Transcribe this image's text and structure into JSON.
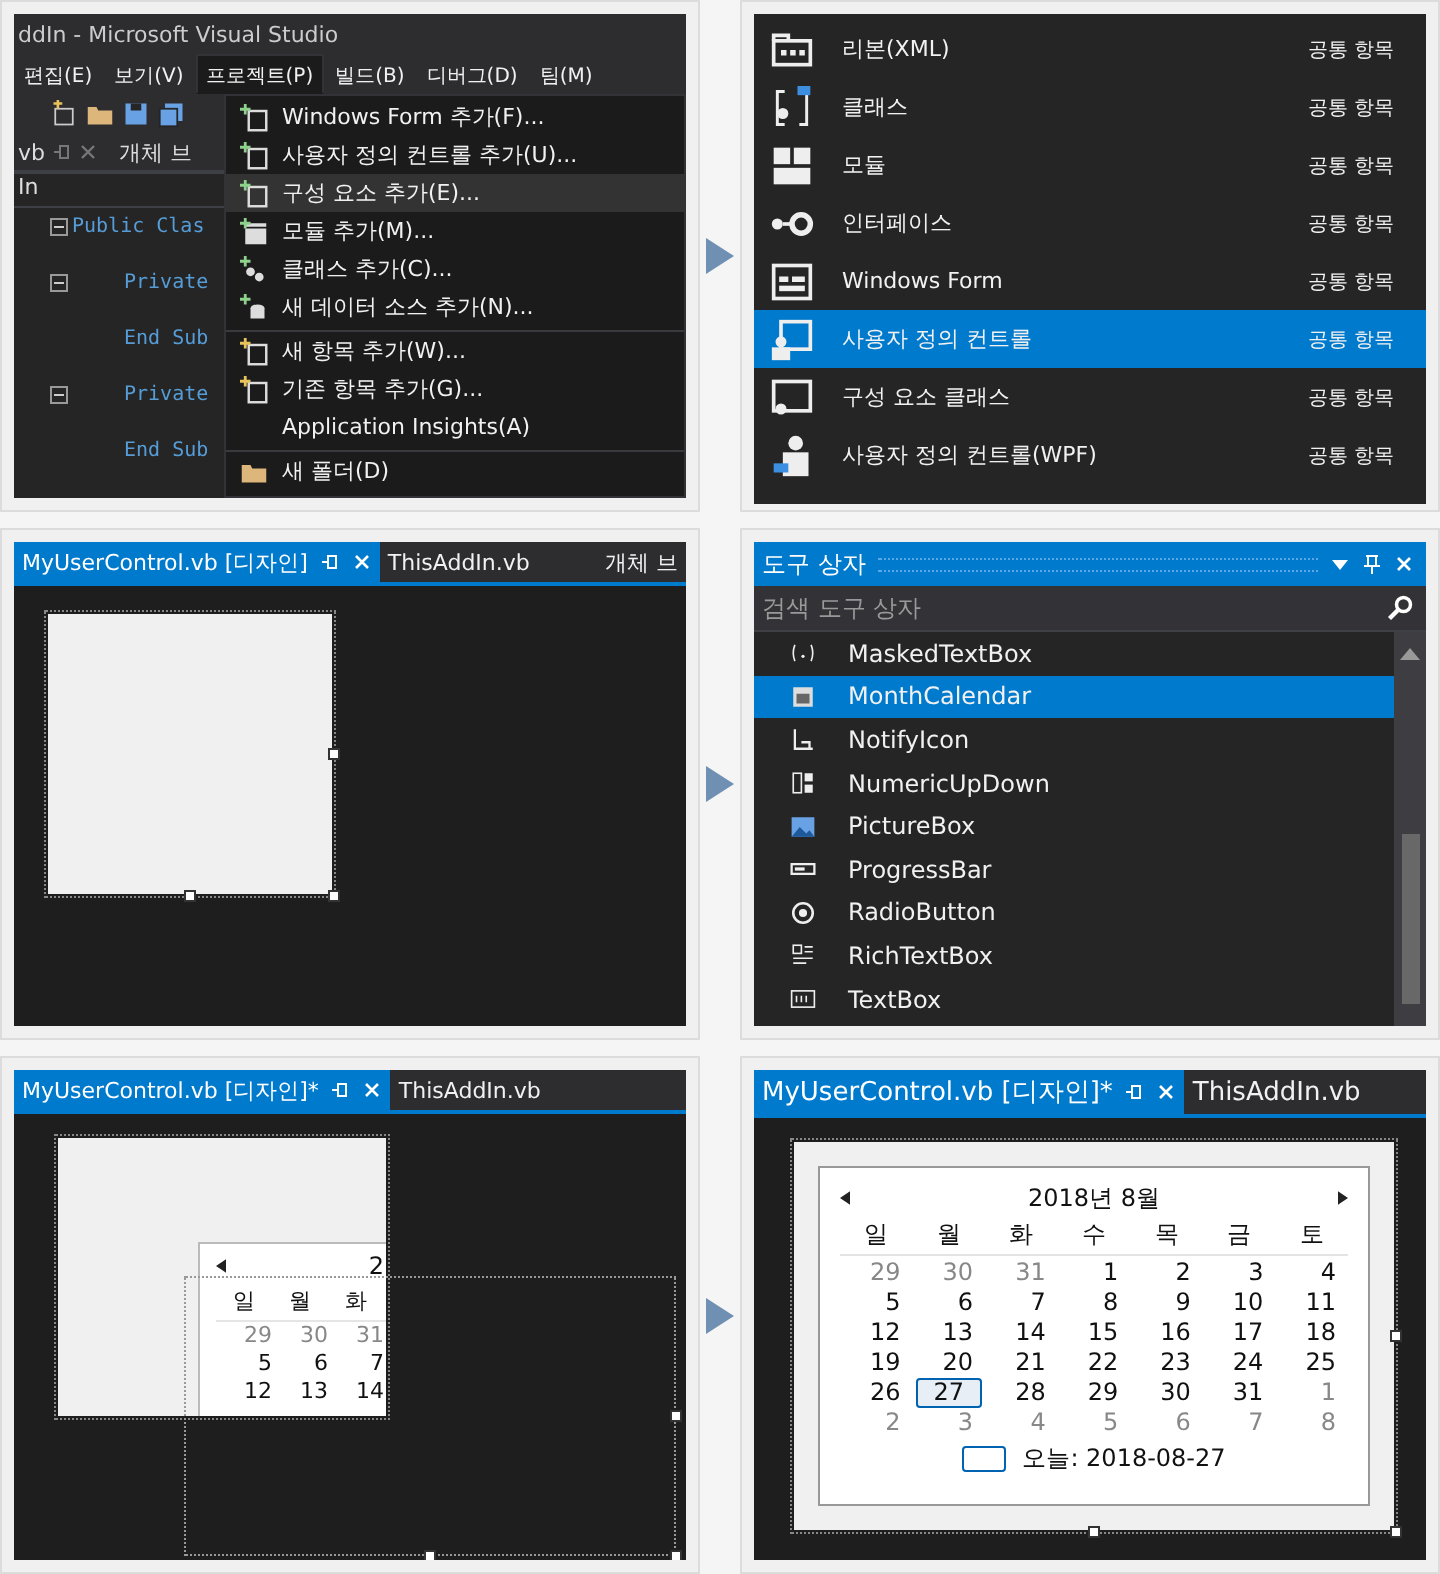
{
  "step1": {
    "window_title": "ddIn - Microsoft Visual Studio",
    "menubar": [
      {
        "label": "편집(E)",
        "selected": false
      },
      {
        "label": "보기(V)",
        "selected": false
      },
      {
        "label": "프로젝트(P)",
        "selected": true
      },
      {
        "label": "빌드(B)",
        "selected": false
      },
      {
        "label": "디버그(D)",
        "selected": false
      },
      {
        "label": "팀(M)",
        "selected": false
      }
    ],
    "editor_tab": "vb",
    "editor_tab_2": "개체 브",
    "breadcrumb": "In",
    "code": [
      {
        "text": "Public Clas",
        "kind": "class"
      },
      {
        "text": "Private",
        "kind": "member"
      },
      {
        "text": "End Sub",
        "kind": "end"
      },
      {
        "text": "Private",
        "kind": "member"
      },
      {
        "text": "End Sub",
        "kind": "end"
      }
    ],
    "menu": [
      {
        "label": "Windows Form 추가(F)...",
        "kind": "form",
        "selected": false,
        "separator_before": false
      },
      {
        "label": "사용자 정의 컨트롤 추가(U)...",
        "kind": "control",
        "selected": false,
        "separator_before": false
      },
      {
        "label": "구성 요소 추가(E)...",
        "kind": "component",
        "selected": true,
        "separator_before": false
      },
      {
        "label": "모듈 추가(M)...",
        "kind": "module",
        "selected": false,
        "separator_before": false
      },
      {
        "label": "클래스 추가(C)...",
        "kind": "class",
        "selected": false,
        "separator_before": false
      },
      {
        "label": "새 데이터 소스 추가(N)...",
        "kind": "datasource",
        "selected": false,
        "separator_before": false
      },
      {
        "label": "새 항목 추가(W)...",
        "kind": "newitem",
        "selected": false,
        "separator_before": true
      },
      {
        "label": "기존 항목 추가(G)...",
        "kind": "existing",
        "selected": false,
        "separator_before": false
      },
      {
        "label": "Application Insights(A)",
        "kind": "none",
        "selected": false,
        "separator_before": false
      },
      {
        "label": "새 폴더(D)",
        "kind": "folder",
        "selected": false,
        "separator_before": true
      }
    ]
  },
  "step2": {
    "templates": [
      {
        "name": "리본(XML)",
        "category": "공통 항목",
        "kind": "ribbon",
        "selected": false
      },
      {
        "name": "클래스",
        "category": "공통 항목",
        "kind": "class",
        "selected": false
      },
      {
        "name": "모듈",
        "category": "공통 항목",
        "kind": "module",
        "selected": false
      },
      {
        "name": "인터페이스",
        "category": "공통 항목",
        "kind": "interface",
        "selected": false
      },
      {
        "name": "Windows Form",
        "category": "공통 항목",
        "kind": "form",
        "selected": false
      },
      {
        "name": "사용자 정의 컨트롤",
        "category": "공통 항목",
        "kind": "usercontrol",
        "selected": true
      },
      {
        "name": "구성 요소 클래스",
        "category": "공통 항목",
        "kind": "component",
        "selected": false
      },
      {
        "name": "사용자 정의 컨트롤(WPF)",
        "category": "공통 항목",
        "kind": "wpf",
        "selected": false
      }
    ]
  },
  "step3": {
    "tabs": [
      {
        "label": "MyUserControl.vb [디자인]",
        "selected": true
      },
      {
        "label": "ThisAddIn.vb",
        "selected": false
      }
    ],
    "extra_tab": "개체 브"
  },
  "step4": {
    "title": "도구 상자",
    "search": {
      "placeholder": "검색 도구 상자"
    },
    "items": [
      {
        "label": "MaskedTextBox",
        "kind": "masked",
        "selected": false
      },
      {
        "label": "MonthCalendar",
        "kind": "calendar",
        "selected": true
      },
      {
        "label": "NotifyIcon",
        "kind": "notify",
        "selected": false
      },
      {
        "label": "NumericUpDown",
        "kind": "numeric",
        "selected": false
      },
      {
        "label": "PictureBox",
        "kind": "picture",
        "selected": false
      },
      {
        "label": "ProgressBar",
        "kind": "progress",
        "selected": false
      },
      {
        "label": "RadioButton",
        "kind": "radio",
        "selected": false
      },
      {
        "label": "RichTextBox",
        "kind": "richtext",
        "selected": false
      },
      {
        "label": "TextBox",
        "kind": "textbox",
        "selected": false
      }
    ]
  },
  "step5": {
    "tabs": [
      {
        "label": "MyUserControl.vb [디자인]*",
        "selected": true
      },
      {
        "label": "ThisAddIn.vb",
        "selected": false
      }
    ],
    "calendar": {
      "title": "2",
      "weekdays": [
        "일",
        "월",
        "화"
      ],
      "weeks": [
        [
          {
            "d": "29",
            "muted": true
          },
          {
            "d": "30",
            "muted": true
          },
          {
            "d": "31",
            "muted": true
          }
        ],
        [
          {
            "d": "5",
            "muted": false
          },
          {
            "d": "6",
            "muted": false
          },
          {
            "d": "7",
            "muted": false
          }
        ],
        [
          {
            "d": "12",
            "muted": false
          },
          {
            "d": "13",
            "muted": false
          },
          {
            "d": "14",
            "muted": false
          }
        ]
      ]
    }
  },
  "step6": {
    "tabs": [
      {
        "label": "MyUserControl.vb [디자인]*",
        "selected": true
      },
      {
        "label": "ThisAddIn.vb",
        "selected": false
      }
    ],
    "calendar": {
      "title": "2018년 8월",
      "weekdays": [
        "일",
        "월",
        "화",
        "수",
        "목",
        "금",
        "토"
      ],
      "weeks": [
        [
          {
            "d": "29",
            "muted": true,
            "selected": false
          },
          {
            "d": "30",
            "muted": true,
            "selected": false
          },
          {
            "d": "31",
            "muted": true,
            "selected": false
          },
          {
            "d": "1",
            "muted": false,
            "selected": false
          },
          {
            "d": "2",
            "muted": false,
            "selected": false
          },
          {
            "d": "3",
            "muted": false,
            "selected": false
          },
          {
            "d": "4",
            "muted": false,
            "selected": false
          }
        ],
        [
          {
            "d": "5",
            "muted": false,
            "selected": false
          },
          {
            "d": "6",
            "muted": false,
            "selected": false
          },
          {
            "d": "7",
            "muted": false,
            "selected": false
          },
          {
            "d": "8",
            "muted": false,
            "selected": false
          },
          {
            "d": "9",
            "muted": false,
            "selected": false
          },
          {
            "d": "10",
            "muted": false,
            "selected": false
          },
          {
            "d": "11",
            "muted": false,
            "selected": false
          }
        ],
        [
          {
            "d": "12",
            "muted": false,
            "selected": false
          },
          {
            "d": "13",
            "muted": false,
            "selected": false
          },
          {
            "d": "14",
            "muted": false,
            "selected": false
          },
          {
            "d": "15",
            "muted": false,
            "selected": false
          },
          {
            "d": "16",
            "muted": false,
            "selected": false
          },
          {
            "d": "17",
            "muted": false,
            "selected": false
          },
          {
            "d": "18",
            "muted": false,
            "selected": false
          }
        ],
        [
          {
            "d": "19",
            "muted": false,
            "selected": false
          },
          {
            "d": "20",
            "muted": false,
            "selected": false
          },
          {
            "d": "21",
            "muted": false,
            "selected": false
          },
          {
            "d": "22",
            "muted": false,
            "selected": false
          },
          {
            "d": "23",
            "muted": false,
            "selected": false
          },
          {
            "d": "24",
            "muted": false,
            "selected": false
          },
          {
            "d": "25",
            "muted": false,
            "selected": false
          }
        ],
        [
          {
            "d": "26",
            "muted": false,
            "selected": false
          },
          {
            "d": "27",
            "muted": false,
            "selected": true
          },
          {
            "d": "28",
            "muted": false,
            "selected": false
          },
          {
            "d": "29",
            "muted": false,
            "selected": false
          },
          {
            "d": "30",
            "muted": false,
            "selected": false
          },
          {
            "d": "31",
            "muted": false,
            "selected": false
          },
          {
            "d": "1",
            "muted": true,
            "selected": false
          }
        ],
        [
          {
            "d": "2",
            "muted": true,
            "selected": false
          },
          {
            "d": "3",
            "muted": true,
            "selected": false
          },
          {
            "d": "4",
            "muted": true,
            "selected": false
          },
          {
            "d": "5",
            "muted": true,
            "selected": false
          },
          {
            "d": "6",
            "muted": true,
            "selected": false
          },
          {
            "d": "7",
            "muted": true,
            "selected": false
          },
          {
            "d": "8",
            "muted": true,
            "selected": false
          }
        ]
      ],
      "today": "오늘: 2018-08-27"
    }
  }
}
